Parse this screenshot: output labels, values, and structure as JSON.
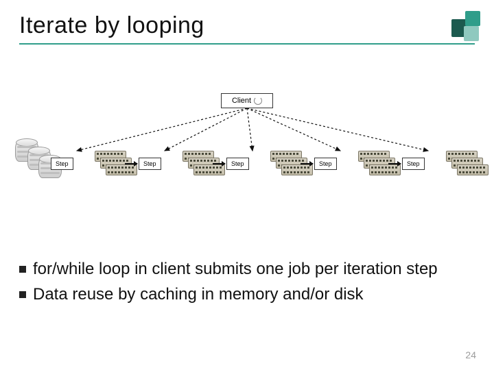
{
  "title": "Iterate by looping",
  "client_label": "Client",
  "step_label": "Step",
  "bullets": [
    "for/while loop in client submits one job per iteration step",
    "Data reuse by caching in memory and/or disk"
  ],
  "page_number": "24",
  "icons": {
    "cycle": "cycle-icon",
    "disk": "disk-icon",
    "ram": "ram-icon"
  },
  "colors": {
    "accent": "#2f9d8a"
  }
}
